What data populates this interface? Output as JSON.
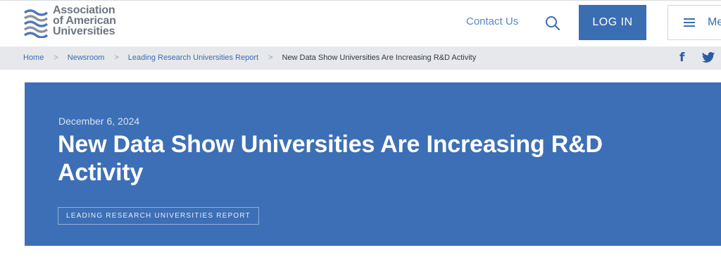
{
  "logo": {
    "line1": "Association",
    "line2": "of American",
    "line3": "Universities"
  },
  "nav": {
    "contact_label": "Contact Us",
    "login_label": "LOG IN",
    "menu_label": "Menu"
  },
  "breadcrumb": {
    "items": [
      "Home",
      "Newsroom",
      "Leading Research Universities Report"
    ],
    "separator": ">",
    "current": "New Data Show Universities Are Increasing R&D Activity"
  },
  "social": {
    "facebook_glyph": "f"
  },
  "hero": {
    "date": "December 6, 2024",
    "title": "New Data Show Universities Are Increasing R&D Activity",
    "tag": "LEADING RESEARCH UNIVERSITIES REPORT"
  },
  "colors": {
    "brand_blue": "#3b6db3",
    "hero_bg": "#3d6fb6",
    "breadcrumb_bg": "#e6e8eb"
  }
}
